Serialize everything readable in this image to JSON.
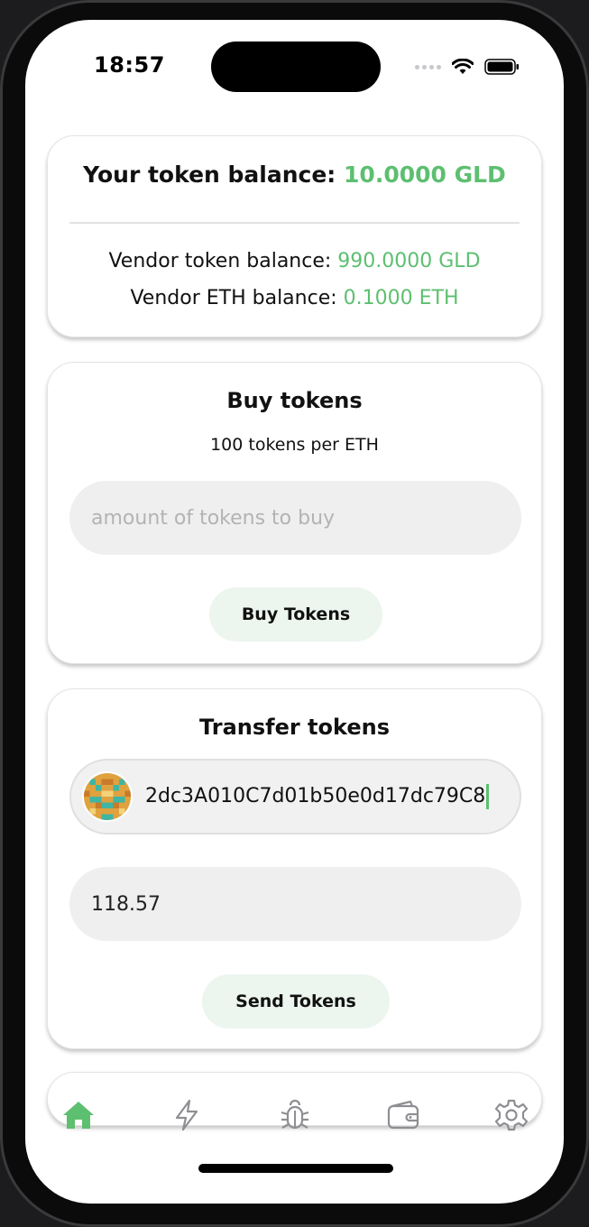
{
  "status_bar": {
    "time": "18:57"
  },
  "balances": {
    "your_label": "Your token balance:",
    "your_value": "10.0000 GLD",
    "vendor_token_label": "Vendor token balance:",
    "vendor_token_value": "990.0000 GLD",
    "vendor_eth_label": "Vendor ETH balance:",
    "vendor_eth_value": "0.1000 ETH"
  },
  "buy": {
    "title": "Buy tokens",
    "rate": "100 tokens per ETH",
    "placeholder": "amount of tokens to buy",
    "button_label": "Buy Tokens"
  },
  "transfer": {
    "title": "Transfer tokens",
    "address_value": "2dc3A010C7d01b50e0d17dc79C8",
    "amount_value": "118.57",
    "button_label": "Send Tokens"
  },
  "tabbar": {
    "items": [
      {
        "icon": "home-icon",
        "active": true
      },
      {
        "icon": "lightning-icon",
        "active": false
      },
      {
        "icon": "bug-icon",
        "active": false
      },
      {
        "icon": "wallet-icon",
        "active": false
      },
      {
        "icon": "gear-icon",
        "active": false
      }
    ],
    "active_color": "#5dbf70",
    "inactive_color": "#8e8e93"
  },
  "colors": {
    "accent_green": "#5dbf70",
    "button_bg": "#ecf5ee",
    "input_bg": "#efefef"
  }
}
